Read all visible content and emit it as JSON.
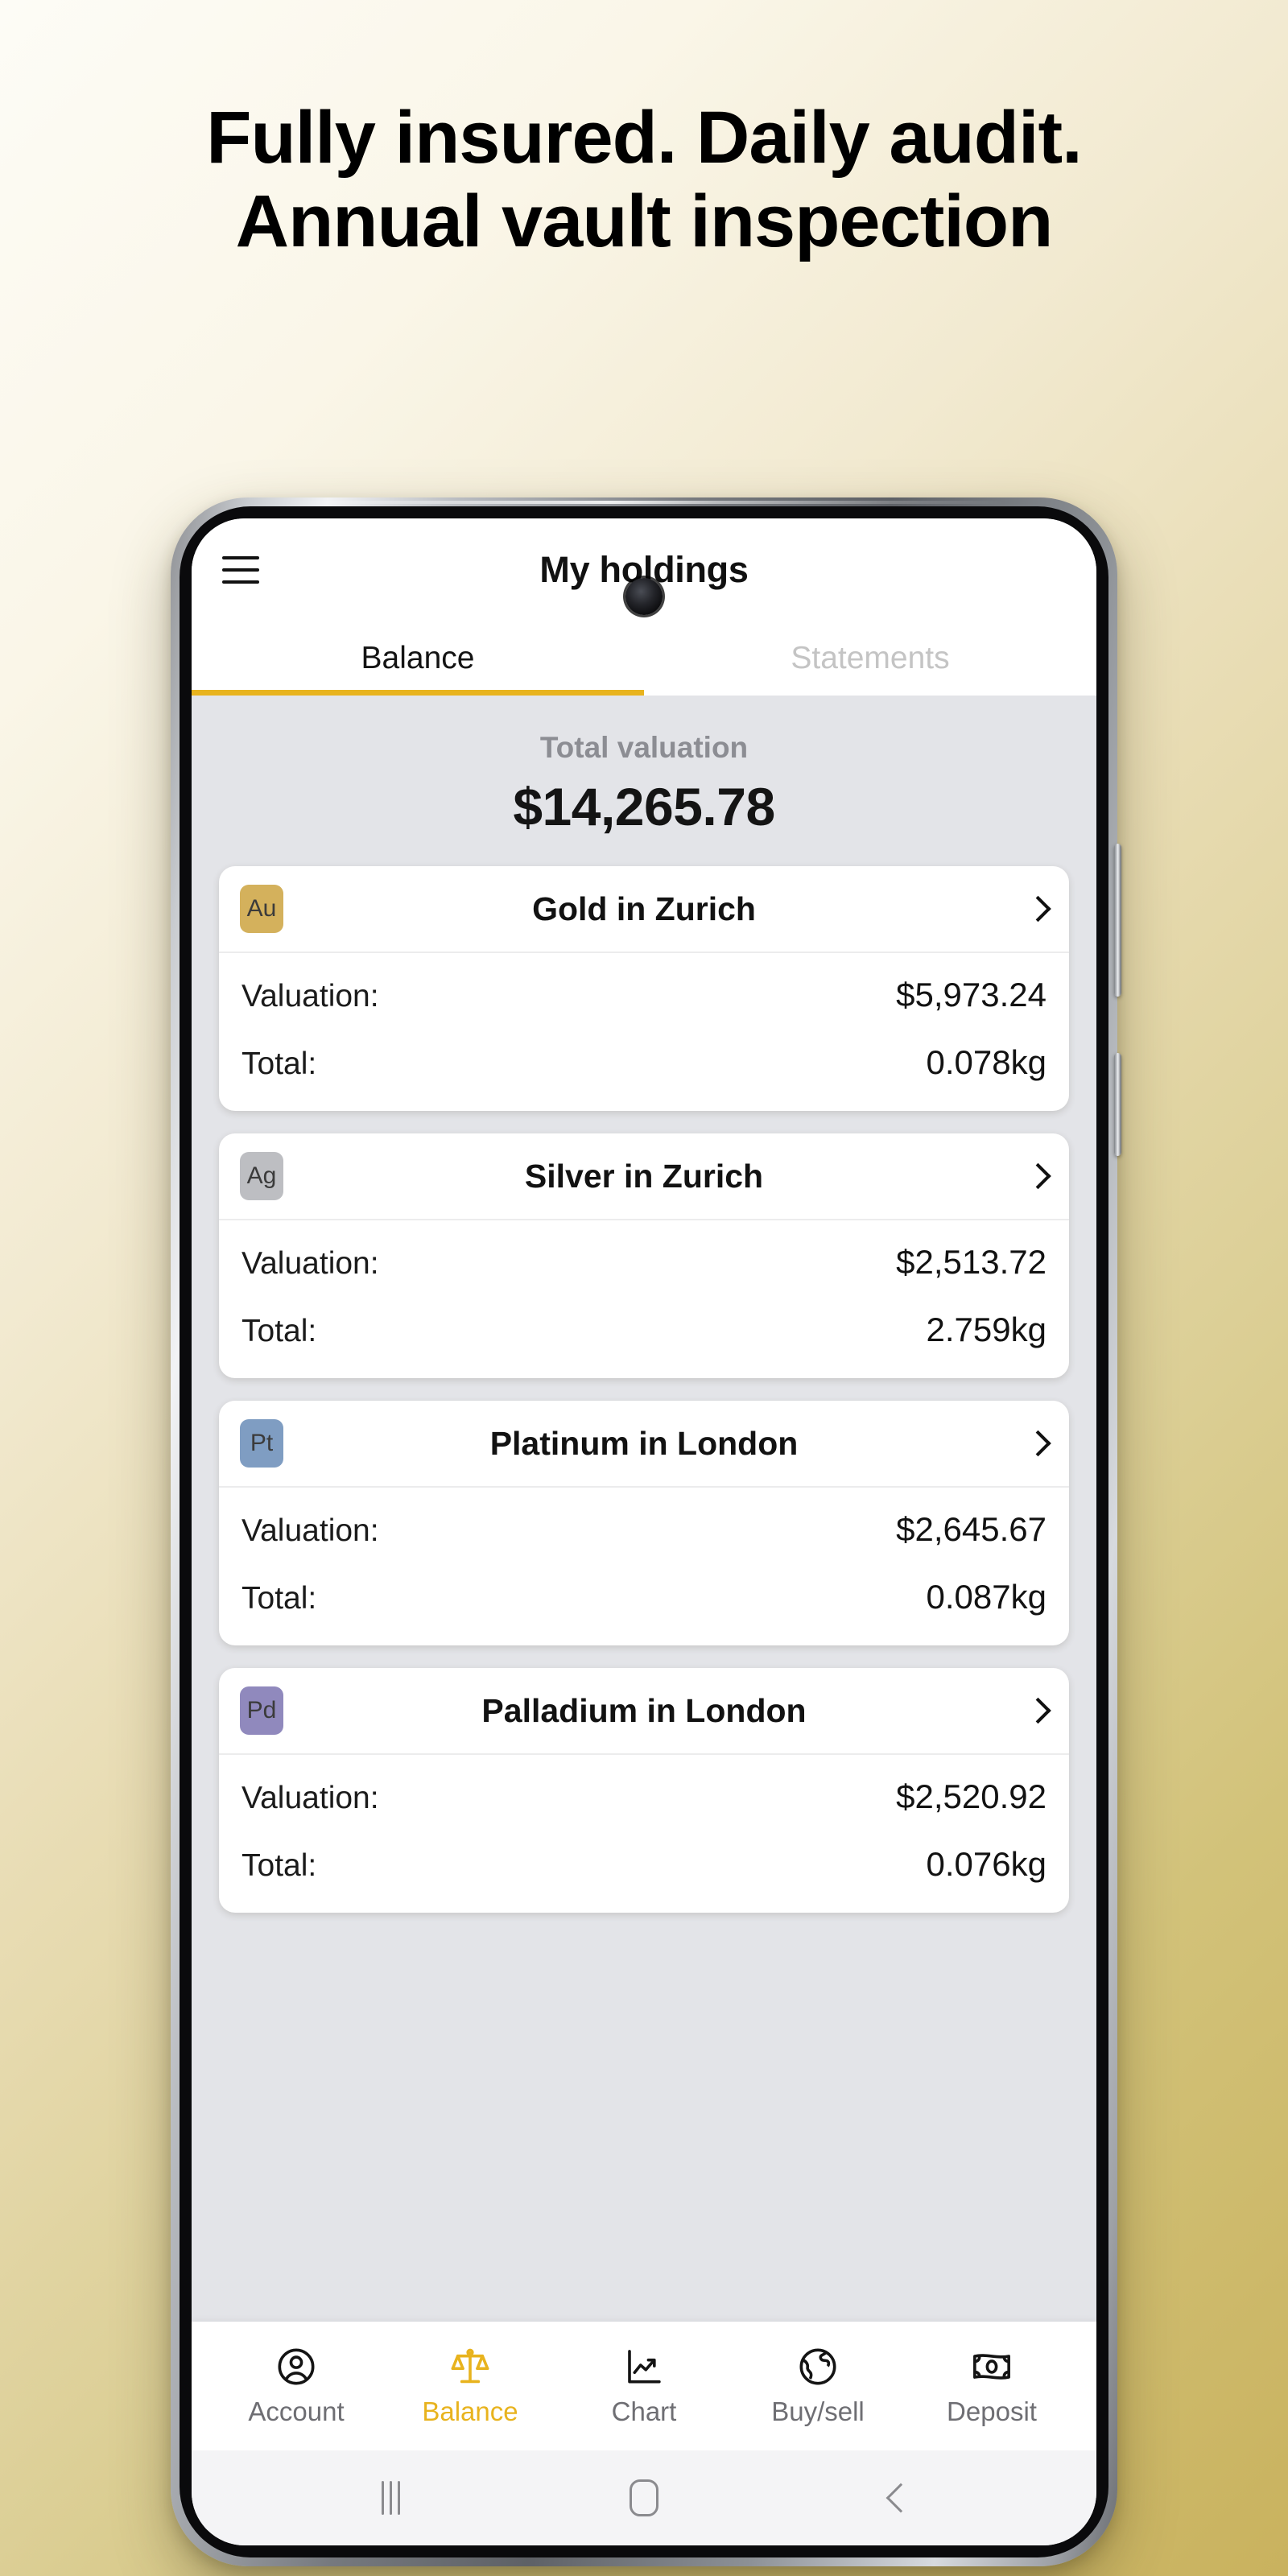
{
  "promo": {
    "headline": "Fully insured. Daily audit. Annual vault inspection"
  },
  "theme": {
    "accent": "#e8b31e",
    "bg_start": "#fdfcf6",
    "bg_end": "#c9b25e",
    "content_bg": "#e3e4e8"
  },
  "app": {
    "title": "My holdings",
    "menu_icon": "hamburger-icon",
    "tabs": [
      {
        "label": "Balance",
        "active": true
      },
      {
        "label": "Statements",
        "active": false
      }
    ],
    "total": {
      "label": "Total valuation",
      "value": "$14,265.78"
    },
    "labels": {
      "valuation": "Valuation:",
      "total": "Total:"
    },
    "holdings": [
      {
        "symbol": "Au",
        "badge_color": "#d4b15c",
        "title": "Gold in Zurich",
        "valuation": "$5,973.24",
        "total": "0.078kg"
      },
      {
        "symbol": "Ag",
        "badge_color": "#bdbec2",
        "title": "Silver in Zurich",
        "valuation": "$2,513.72",
        "total": "2.759kg"
      },
      {
        "symbol": "Pt",
        "badge_color": "#7f9dc2",
        "title": "Platinum in London",
        "valuation": "$2,645.67",
        "total": "0.087kg"
      },
      {
        "symbol": "Pd",
        "badge_color": "#9089bd",
        "title": "Palladium in London",
        "valuation": "$2,520.92",
        "total": "0.076kg"
      }
    ],
    "bottom_nav": [
      {
        "label": "Account",
        "icon": "person-circle-icon",
        "active": false
      },
      {
        "label": "Balance",
        "icon": "scales-icon",
        "active": true
      },
      {
        "label": "Chart",
        "icon": "chart-line-icon",
        "active": false
      },
      {
        "label": "Buy/sell",
        "icon": "globe-icon",
        "active": false
      },
      {
        "label": "Deposit",
        "icon": "banknote-icon",
        "active": false
      }
    ]
  },
  "system_nav": {
    "recents": "recents-icon",
    "home": "home-icon",
    "back": "back-icon"
  }
}
